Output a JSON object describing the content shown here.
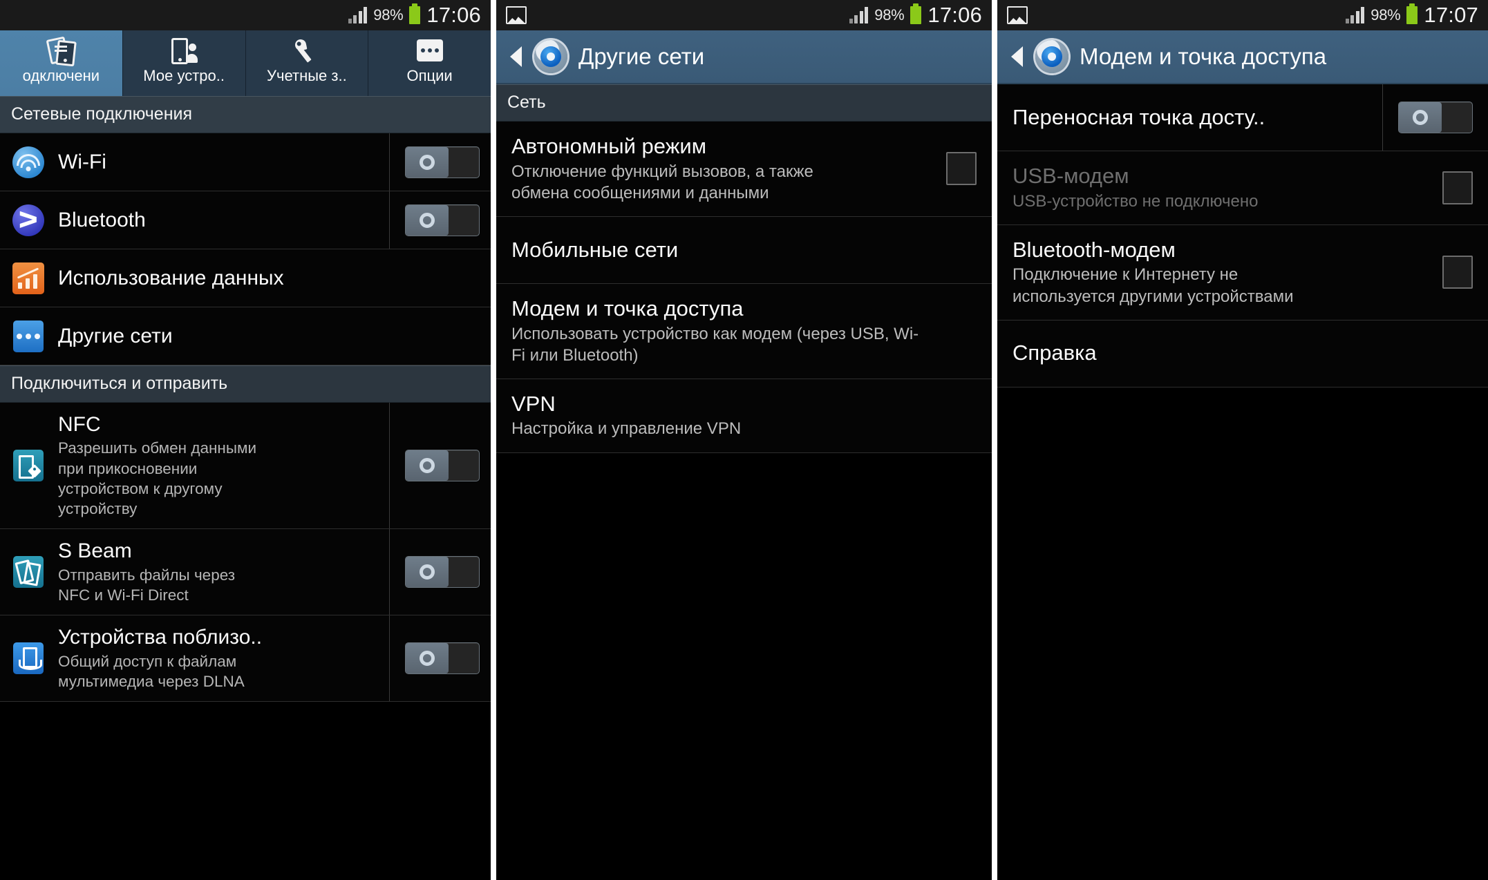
{
  "panel1": {
    "statusbar": {
      "battery_percent": "98%",
      "time": "17:06"
    },
    "tabs": [
      {
        "label": "одключени",
        "icon": "connections-icon",
        "active": true
      },
      {
        "label": "Мое устро..",
        "icon": "my-device-icon",
        "active": false
      },
      {
        "label": "Учетные з..",
        "icon": "accounts-icon",
        "active": false
      },
      {
        "label": "Опции",
        "icon": "more-options-icon",
        "active": false
      }
    ],
    "section1": "Сетевые подключения",
    "section2": "Подключиться и отправить",
    "rows": [
      {
        "title": "Wi-Fi",
        "sub": "",
        "icon": "wifi-icon",
        "control": "toggle",
        "state": "off"
      },
      {
        "title": "Bluetooth",
        "sub": "",
        "icon": "bluetooth-icon",
        "control": "toggle",
        "state": "off"
      },
      {
        "title": "Использование данных",
        "sub": "",
        "icon": "data-usage-icon",
        "control": "none"
      },
      {
        "title": "Другие сети",
        "sub": "",
        "icon": "other-networks-icon",
        "control": "none"
      },
      {
        "title": "NFC",
        "sub": "Разрешить обмен данными при прикосновении устройством к другому устройству",
        "icon": "nfc-icon",
        "control": "toggle",
        "state": "off"
      },
      {
        "title": "S Beam",
        "sub": "Отправить файлы через NFC и Wi-Fi Direct",
        "icon": "s-beam-icon",
        "control": "toggle",
        "state": "off"
      },
      {
        "title": "Устройства поблизо..",
        "sub": "Общий доступ к файлам мультимедиа через DLNA",
        "icon": "nearby-devices-icon",
        "control": "toggle",
        "state": "off"
      }
    ]
  },
  "panel2": {
    "statusbar": {
      "battery_percent": "98%",
      "time": "17:06",
      "left_icon": "photo-icon"
    },
    "actionbar": {
      "title": "Другие сети",
      "back": "back-chevron",
      "icon": "settings-gear-icon"
    },
    "section": "Сеть",
    "rows": [
      {
        "title": "Автономный режим",
        "sub": "Отключение функций вызовов, а также обмена сообщениями и данными",
        "control": "checkbox",
        "state": "unchecked"
      },
      {
        "title": "Мобильные сети",
        "sub": "",
        "control": "none"
      },
      {
        "title": "Модем и точка доступа",
        "sub": "Использовать устройство как модем (через USB, Wi-Fi или Bluetooth)",
        "control": "none"
      },
      {
        "title": "VPN",
        "sub": "Настройка и управление VPN",
        "control": "none"
      }
    ]
  },
  "panel3": {
    "statusbar": {
      "battery_percent": "98%",
      "time": "17:07",
      "left_icon": "photo-icon"
    },
    "actionbar": {
      "title": "Модем и точка доступа",
      "back": "back-chevron",
      "icon": "settings-gear-icon"
    },
    "rows": [
      {
        "title": "Переносная точка досту..",
        "sub": "",
        "control": "toggle",
        "state": "off",
        "disabled": false
      },
      {
        "title": "USB-модем",
        "sub": "USB-устройство не подключено",
        "control": "checkbox",
        "state": "unchecked",
        "disabled": true
      },
      {
        "title": "Bluetooth-модем",
        "sub": "Подключение к Интернету не используется другими устройствами",
        "control": "checkbox",
        "state": "unchecked",
        "disabled": false
      },
      {
        "title": "Справка",
        "sub": "",
        "control": "none",
        "disabled": false
      }
    ]
  },
  "colors": {
    "accent_blue": "#4c7ea4",
    "actionbar_blue": "#3f617f",
    "section_gray": "#313d47",
    "battery_green": "#8bc919"
  }
}
